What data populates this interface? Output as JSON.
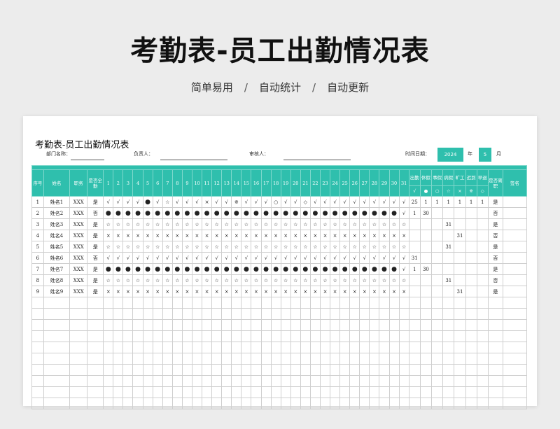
{
  "hero": {
    "title": "考勤表-员工出勤情况表",
    "sub1": "简单易用",
    "sub2": "自动统计",
    "sub3": "自动更新",
    "separator": "/"
  },
  "sheet": {
    "title": "考勤表-员工出勤情况表",
    "dept_label": "部门名称：",
    "manager_label": "负责人：",
    "reviewer_label": "审核人：",
    "date_label": "时间日期：",
    "year": "2024",
    "year_unit": "年",
    "month": "5",
    "month_unit": "月"
  },
  "colors": {
    "accent": "#2fbfad",
    "accent_light": "#7fd8cc"
  },
  "table": {
    "headers": {
      "seq": "序号",
      "name": "姓名",
      "role": "职务",
      "full": "是否全勤",
      "days": [
        "1",
        "2",
        "3",
        "4",
        "5",
        "6",
        "7",
        "8",
        "9",
        "10",
        "11",
        "12",
        "13",
        "14",
        "15",
        "16",
        "17",
        "18",
        "19",
        "20",
        "21",
        "22",
        "23",
        "24",
        "25",
        "26",
        "27",
        "28",
        "29",
        "30",
        "31"
      ],
      "stats": [
        "出勤",
        "休假",
        "事假",
        "病假",
        "旷工",
        "迟到",
        "早退"
      ],
      "stat_symbols": [
        "√",
        "●",
        "○",
        "☆",
        "×",
        "※",
        "◇"
      ],
      "resigned": "是否离职",
      "sign": "签名"
    },
    "rows": [
      {
        "seq": "1",
        "name": "姓名1",
        "role": "XXX",
        "full": "是",
        "days": [
          "√",
          "√",
          "√",
          "√",
          "●",
          "√",
          "☆",
          "√",
          "√",
          "√",
          "×",
          "√",
          "√",
          "※",
          "√",
          "√",
          "√",
          "○",
          "√",
          "√",
          "◇",
          "√",
          "√",
          "√",
          "√",
          "√",
          "√",
          "√",
          "√",
          "√",
          "√"
        ],
        "stats": [
          "25",
          "1",
          "1",
          "1",
          "1",
          "1",
          "1"
        ],
        "resigned": "是"
      },
      {
        "seq": "2",
        "name": "姓名2",
        "role": "XXX",
        "full": "否",
        "days": [
          "●",
          "●",
          "●",
          "●",
          "●",
          "●",
          "●",
          "●",
          "●",
          "●",
          "●",
          "●",
          "●",
          "●",
          "●",
          "●",
          "●",
          "●",
          "●",
          "●",
          "●",
          "●",
          "●",
          "●",
          "●",
          "●",
          "●",
          "●",
          "●",
          "●",
          "√"
        ],
        "stats": [
          "1",
          "30",
          "",
          "",
          "",
          "",
          ""
        ],
        "resigned": "否"
      },
      {
        "seq": "3",
        "name": "姓名3",
        "role": "XXX",
        "full": "是",
        "days": [
          "☆",
          "☆",
          "☆",
          "☆",
          "☆",
          "☆",
          "☆",
          "☆",
          "☆",
          "☆",
          "☆",
          "☆",
          "☆",
          "☆",
          "☆",
          "☆",
          "☆",
          "☆",
          "☆",
          "☆",
          "☆",
          "☆",
          "☆",
          "☆",
          "☆",
          "☆",
          "☆",
          "☆",
          "☆",
          "☆",
          "☆"
        ],
        "stats": [
          "",
          "",
          "",
          "31",
          "",
          "",
          ""
        ],
        "resigned": "是"
      },
      {
        "seq": "4",
        "name": "姓名4",
        "role": "XXX",
        "full": "是",
        "days": [
          "×",
          "×",
          "×",
          "×",
          "×",
          "×",
          "×",
          "×",
          "×",
          "×",
          "×",
          "×",
          "×",
          "×",
          "×",
          "×",
          "×",
          "×",
          "×",
          "×",
          "×",
          "×",
          "×",
          "×",
          "×",
          "×",
          "×",
          "×",
          "×",
          "×",
          "×"
        ],
        "stats": [
          "",
          "",
          "",
          "",
          "31",
          "",
          ""
        ],
        "resigned": "否"
      },
      {
        "seq": "5",
        "name": "姓名5",
        "role": "XXX",
        "full": "是",
        "days": [
          "☆",
          "☆",
          "☆",
          "☆",
          "☆",
          "☆",
          "☆",
          "☆",
          "☆",
          "☆",
          "☆",
          "☆",
          "☆",
          "☆",
          "☆",
          "☆",
          "☆",
          "☆",
          "☆",
          "☆",
          "☆",
          "☆",
          "☆",
          "☆",
          "☆",
          "☆",
          "☆",
          "☆",
          "☆",
          "☆",
          "☆"
        ],
        "stats": [
          "",
          "",
          "",
          "31",
          "",
          "",
          ""
        ],
        "resigned": "是"
      },
      {
        "seq": "6",
        "name": "姓名6",
        "role": "XXX",
        "full": "否",
        "days": [
          "√",
          "√",
          "√",
          "√",
          "√",
          "√",
          "√",
          "√",
          "√",
          "√",
          "√",
          "√",
          "√",
          "√",
          "√",
          "√",
          "√",
          "√",
          "√",
          "√",
          "√",
          "√",
          "√",
          "√",
          "√",
          "√",
          "√",
          "√",
          "√",
          "√",
          "√"
        ],
        "stats": [
          "31",
          "",
          "",
          "",
          "",
          "",
          ""
        ],
        "resigned": "否"
      },
      {
        "seq": "7",
        "name": "姓名7",
        "role": "XXX",
        "full": "是",
        "days": [
          "●",
          "●",
          "●",
          "●",
          "●",
          "●",
          "●",
          "●",
          "●",
          "●",
          "●",
          "●",
          "●",
          "●",
          "●",
          "●",
          "●",
          "●",
          "●",
          "●",
          "●",
          "●",
          "●",
          "●",
          "●",
          "●",
          "●",
          "●",
          "●",
          "●",
          "√"
        ],
        "stats": [
          "1",
          "30",
          "",
          "",
          "",
          "",
          ""
        ],
        "resigned": "是"
      },
      {
        "seq": "8",
        "name": "姓名8",
        "role": "XXX",
        "full": "是",
        "days": [
          "☆",
          "☆",
          "☆",
          "☆",
          "☆",
          "☆",
          "☆",
          "☆",
          "☆",
          "☆",
          "☆",
          "☆",
          "☆",
          "☆",
          "☆",
          "☆",
          "☆",
          "☆",
          "☆",
          "☆",
          "☆",
          "☆",
          "☆",
          "☆",
          "☆",
          "☆",
          "☆",
          "☆",
          "☆",
          "☆",
          "☆"
        ],
        "stats": [
          "",
          "",
          "",
          "31",
          "",
          "",
          ""
        ],
        "resigned": "否"
      },
      {
        "seq": "9",
        "name": "姓名9",
        "role": "XXX",
        "full": "是",
        "days": [
          "×",
          "×",
          "×",
          "×",
          "×",
          "×",
          "×",
          "×",
          "×",
          "×",
          "×",
          "×",
          "×",
          "×",
          "×",
          "×",
          "×",
          "×",
          "×",
          "×",
          "×",
          "×",
          "×",
          "×",
          "×",
          "×",
          "×",
          "×",
          "×",
          "×",
          "×"
        ],
        "stats": [
          "",
          "",
          "",
          "",
          "31",
          "",
          ""
        ],
        "resigned": "是"
      }
    ],
    "empty_rows": 10
  }
}
